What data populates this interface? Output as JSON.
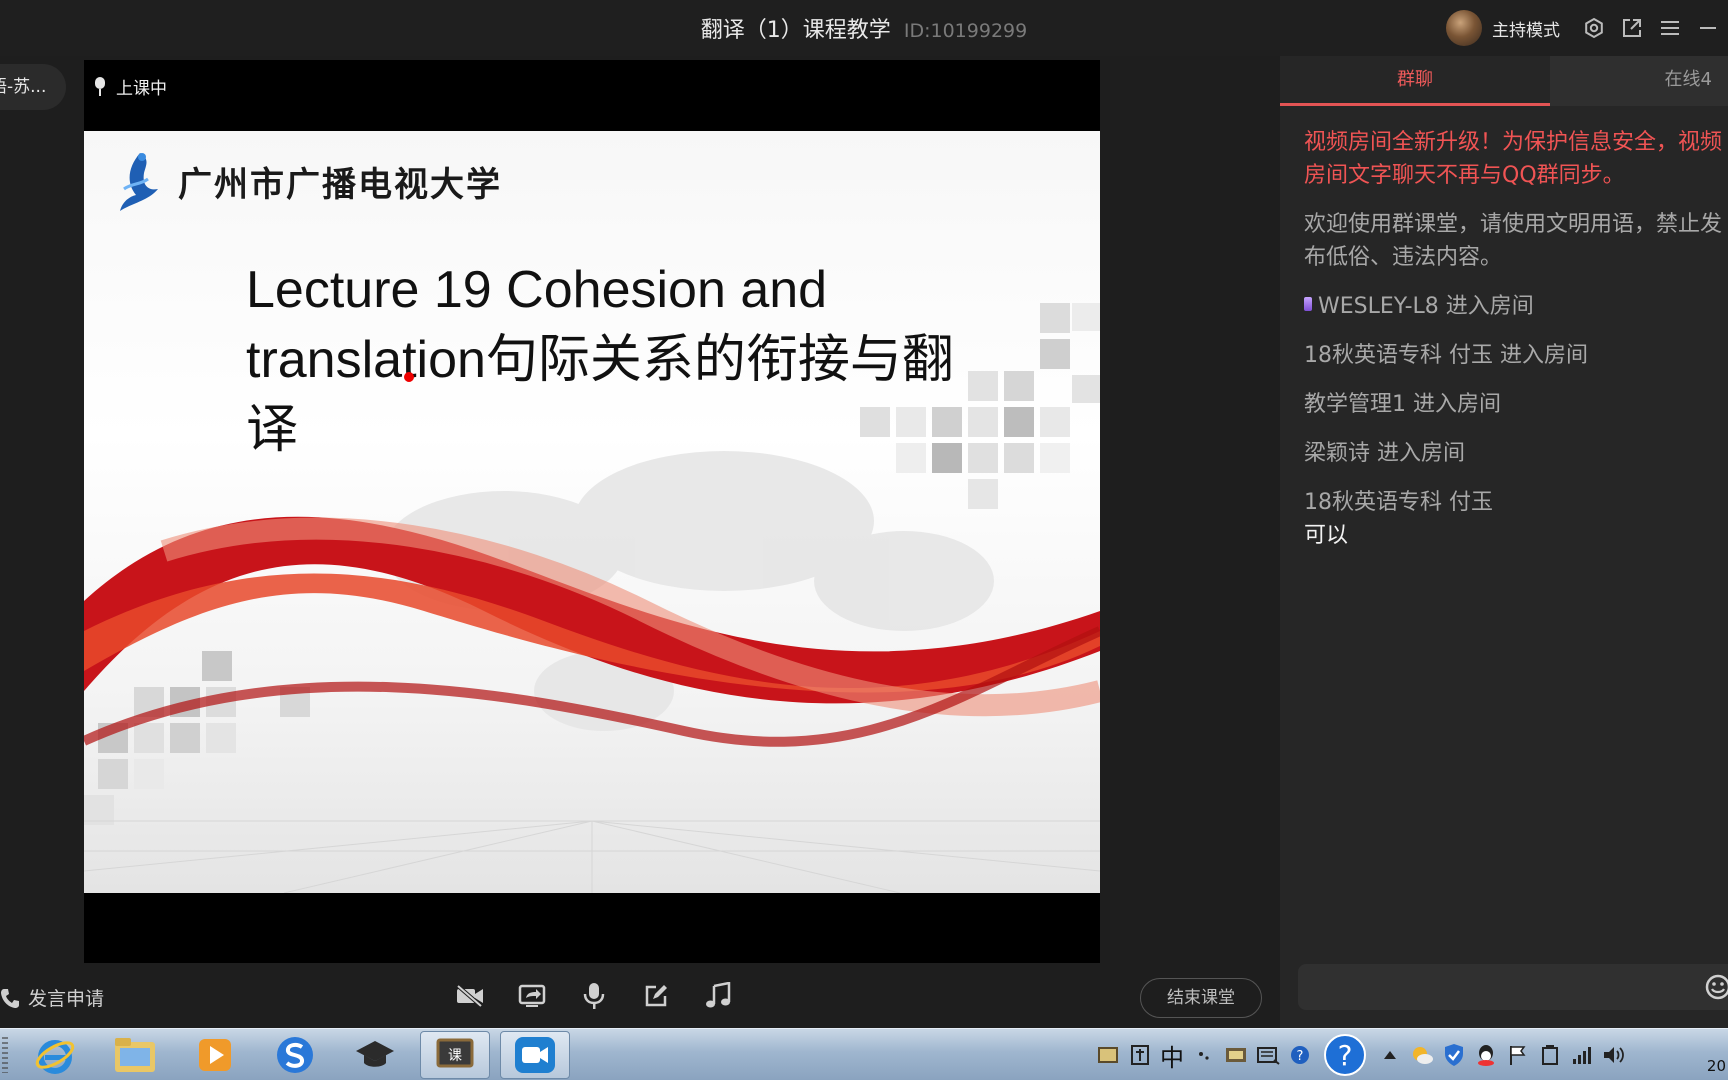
{
  "header": {
    "title": "翻译（1）课程教学",
    "room_id": "ID:10199299",
    "host_mode_label": "主持模式",
    "icons": [
      "avatar",
      "settings-icon",
      "popout-icon",
      "menu-icon",
      "minimize-icon"
    ]
  },
  "stage": {
    "left_chip_label": "语-苏...",
    "live_label": "上课中",
    "slide": {
      "university_name": "广州市广播电视大学",
      "lecture_title": "Lecture 19 Cohesion and translation句际关系的衔接与翻译"
    }
  },
  "toolbar": {
    "speak_request_label": "发言申请",
    "tools": [
      "camera-off-icon",
      "screen-share-icon",
      "microphone-icon",
      "edit-icon",
      "music-icon"
    ],
    "end_class_label": "结束课堂"
  },
  "chat": {
    "tabs": [
      {
        "label": "群聊",
        "active": true
      },
      {
        "label": "在线4",
        "active": false
      }
    ],
    "notice": "视频房间全新升级！为保护信息安全，视频房间文字聊天不再与QQ群同步。",
    "info": "欢迎使用群课堂，请使用文明用语，禁止发布低俗、违法内容。",
    "events": [
      "WESLEY-L8 进入房间",
      "18秋英语专科 付玉 进入房间",
      "教学管理1 进入房间",
      "梁颖诗 进入房间"
    ],
    "messages": [
      {
        "name": "18秋英语专科 付玉",
        "text": "可以"
      }
    ]
  },
  "taskbar": {
    "apps": [
      "ie-icon",
      "explorer-icon",
      "media-player-icon",
      "sogou-icon",
      "graduation-cap-icon",
      "ke-app-icon",
      "video-call-icon"
    ],
    "ime_label": "中",
    "clock_partial": "20"
  },
  "colors": {
    "accent": "#e35454",
    "panel": "#262626",
    "stage_bg": "#000000",
    "taskbar": "#9fb6cf"
  }
}
